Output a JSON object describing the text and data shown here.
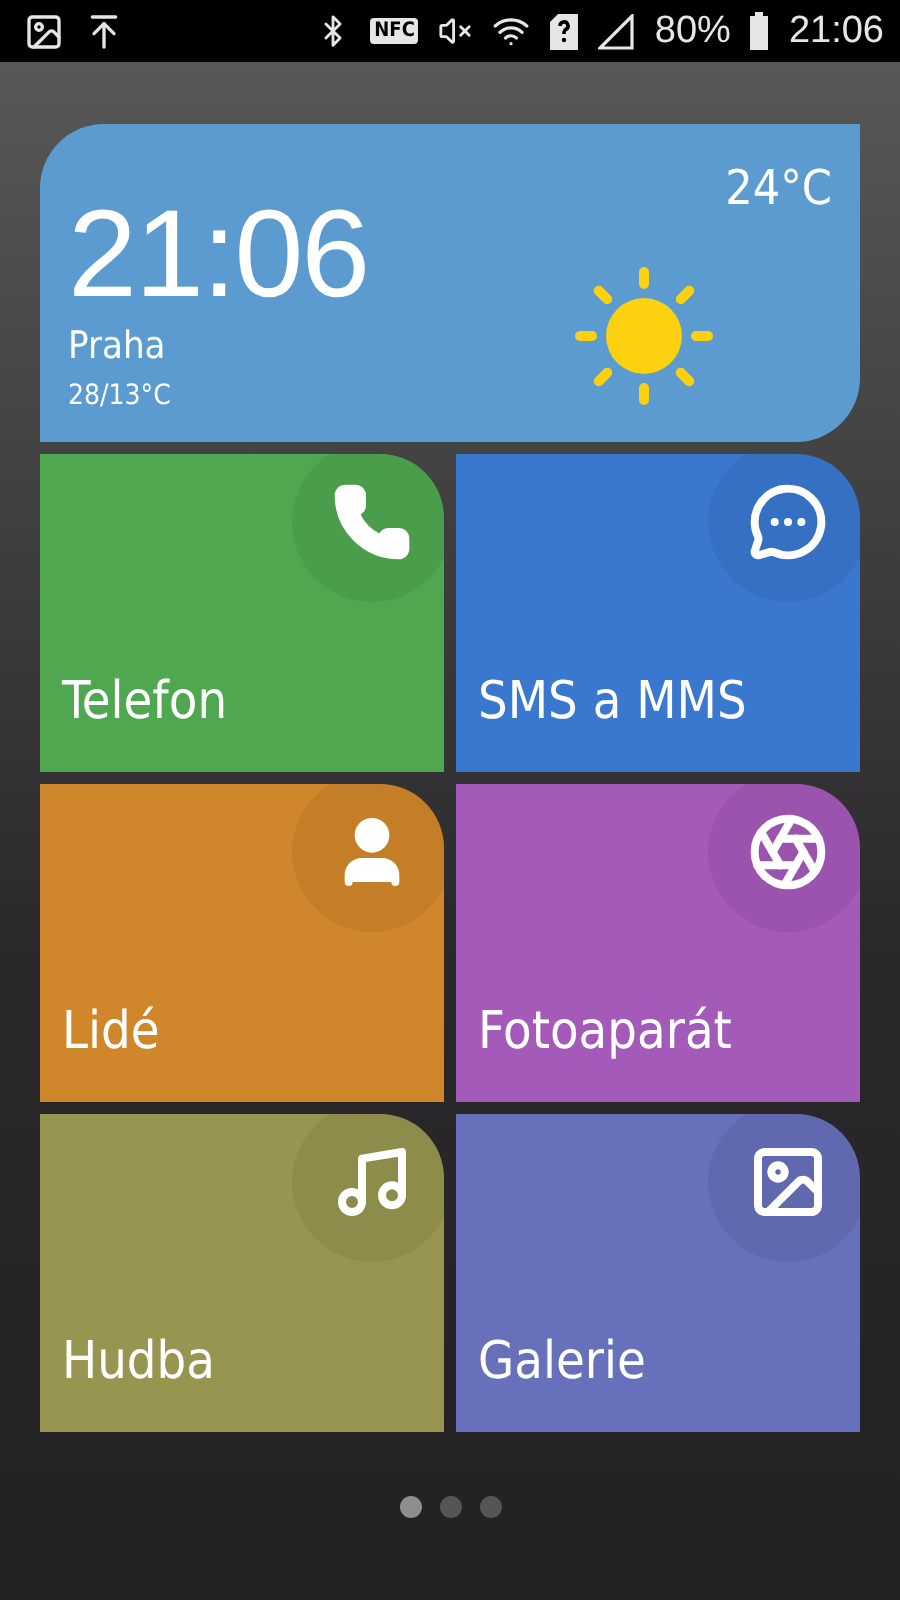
{
  "status_bar": {
    "nfc": "NFC",
    "battery": "80%",
    "time": "21:06"
  },
  "weather": {
    "time": "21:06",
    "city": "Praha",
    "range": "28/13°C",
    "temperature": "24°C"
  },
  "tiles": [
    {
      "label": "Telefon",
      "color": "#4fa74f"
    },
    {
      "label": "SMS a MMS",
      "color": "#3a78d0"
    },
    {
      "label": "Lidé",
      "color": "#d0862a"
    },
    {
      "label": "Fotoaparát",
      "color": "#a45ab8"
    },
    {
      "label": "Hudba",
      "color": "#979550"
    },
    {
      "label": "Galerie",
      "color": "#6770ba"
    }
  ],
  "pages": [
    {
      "selected": true
    },
    {
      "selected": false
    },
    {
      "selected": false
    }
  ]
}
